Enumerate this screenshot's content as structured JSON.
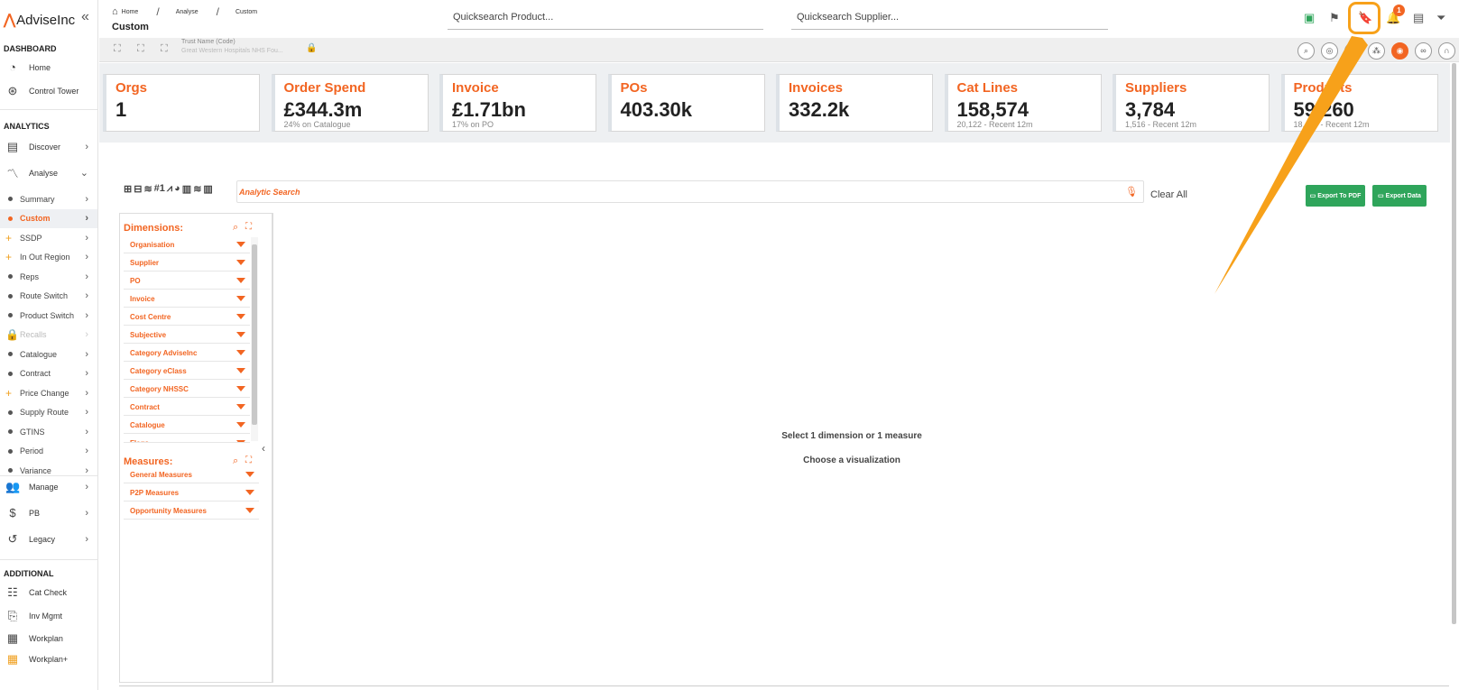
{
  "app": {
    "logo_text": "AdviseInc",
    "collapse_glyph": "«"
  },
  "sidebar": {
    "sections": {
      "dashboard": "DASHBOARD",
      "analytics": "ANALYTICS",
      "additional": "ADDITIONAL"
    },
    "dashboard_items": [
      {
        "label": "Home",
        "icon": "gauge-icon"
      },
      {
        "label": "Control Tower",
        "icon": "broadcast-tower-icon"
      }
    ],
    "analytics_items": [
      {
        "label": "Discover",
        "icon": "discover-icon"
      },
      {
        "label": "Analyse",
        "icon": "analyse-icon"
      }
    ],
    "analyse_sub": [
      {
        "label": "Summary",
        "bullet": "dot"
      },
      {
        "label": "Custom",
        "bullet": "dot",
        "active": true
      },
      {
        "label": "SSDP",
        "bullet": "plus"
      },
      {
        "label": "In Out Region",
        "bullet": "plus"
      },
      {
        "label": "Reps",
        "bullet": "dot"
      },
      {
        "label": "Route Switch",
        "bullet": "dot"
      },
      {
        "label": "Product Switch",
        "bullet": "dot"
      },
      {
        "label": "Recalls",
        "bullet": "lock",
        "disabled": true
      },
      {
        "label": "Catalogue",
        "bullet": "dot"
      },
      {
        "label": "Contract",
        "bullet": "dot"
      },
      {
        "label": "Price Change",
        "bullet": "plus"
      },
      {
        "label": "Supply Route",
        "bullet": "dot"
      },
      {
        "label": "GTINS",
        "bullet": "dot"
      },
      {
        "label": "Period",
        "bullet": "dot"
      },
      {
        "label": "Variance",
        "bullet": "dot"
      }
    ],
    "other_items": [
      {
        "label": "Manage",
        "icon": "users-icon"
      },
      {
        "label": "PB",
        "icon": "dollar-icon"
      },
      {
        "label": "Legacy",
        "icon": "history-icon"
      }
    ],
    "additional_items": [
      {
        "label": "Cat Check",
        "icon": "catalogue-check-icon"
      },
      {
        "label": "Inv Mgmt",
        "icon": "clipboard-icon"
      },
      {
        "label": "Workplan",
        "icon": "calendar-icon"
      },
      {
        "label": "Workplan+",
        "icon": "calendar-plus-icon"
      }
    ]
  },
  "header": {
    "breadcrumb": [
      "Home",
      "Analyse",
      "Custom"
    ],
    "title": "Custom",
    "quicksearch_product": "Quicksearch Product...",
    "quicksearch_supplier": "Quicksearch Supplier...",
    "notification_count": "1"
  },
  "toolbar": {
    "trust_label": "Trust Name (Code)",
    "trust_value": "Great Western Hospitals NHS Fou..."
  },
  "kpis": [
    {
      "title": "Orgs",
      "value": "1",
      "sub": ""
    },
    {
      "title": "Order Spend",
      "value": "£344.3m",
      "sub": "24% on Catalogue"
    },
    {
      "title": "Invoice",
      "value": "£1.71bn",
      "sub": "17% on PO"
    },
    {
      "title": "POs",
      "value": "403.30k",
      "sub": ""
    },
    {
      "title": "Invoices",
      "value": "332.2k",
      "sub": ""
    },
    {
      "title": "Cat Lines",
      "value": "158,574",
      "sub": "20,122 - Recent 12m"
    },
    {
      "title": "Suppliers",
      "value": "3,784",
      "sub": "1,516 - Recent 12m"
    },
    {
      "title": "Products",
      "value": "59,260",
      "sub": "18,449 - Recent 12m"
    }
  ],
  "analytics": {
    "search_placeholder": "Analytic Search",
    "clear_all": "Clear All",
    "export_pdf": "Export To PDF",
    "export_data": "Export Data",
    "dimensions_title": "Dimensions:",
    "measures_title": "Measures:",
    "dimensions": [
      "Organisation",
      "Supplier",
      "PO",
      "Invoice",
      "Cost Centre",
      "Subjective",
      "Category AdviseInc",
      "Category eClass",
      "Category NHSSC",
      "Contract",
      "Catalogue",
      "Flags"
    ],
    "measures": [
      "General Measures",
      "P2P Measures",
      "Opportunity Measures"
    ],
    "empty_msg_1": "Select 1 dimension or 1 measure",
    "empty_msg_2": "Choose a visualization"
  },
  "colors": {
    "accent": "#f26522",
    "green": "#2fa55b",
    "highlight": "#f7a11a"
  }
}
